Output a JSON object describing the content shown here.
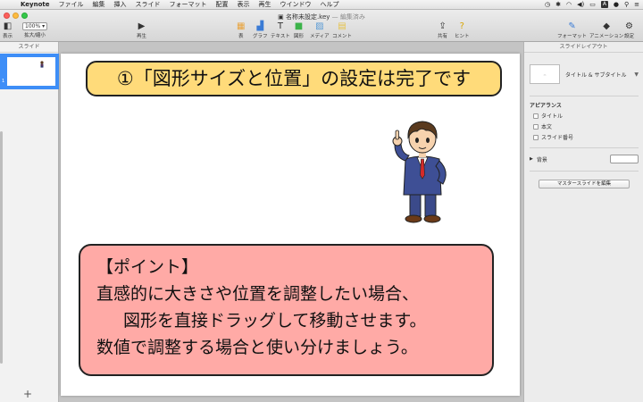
{
  "menubar": {
    "app_name": "Keynote",
    "items": [
      "ファイル",
      "編集",
      "挿入",
      "スライド",
      "フォーマット",
      "配置",
      "表示",
      "再生",
      "ウインドウ",
      "ヘルプ"
    ]
  },
  "window": {
    "doc_title": "名称未設定.key",
    "doc_status": " — 編集済み"
  },
  "toolbar": {
    "view_label": "表示",
    "zoom_value": "100%",
    "zoom_label": "拡大/縮小",
    "play_label": "再生",
    "table_label": "表",
    "chart_label": "グラフ",
    "text_label": "テキスト",
    "shape_label": "図形",
    "media_label": "メディア",
    "comment_label": "コメント",
    "share_label": "共有",
    "tips_label": "ヒント",
    "format_label": "フォーマット",
    "animate_label": "アニメーション",
    "setup_label": "設定"
  },
  "sidebar": {
    "header": "スライド",
    "slide_number": "1",
    "add_label": "+"
  },
  "slide": {
    "title": "①「図形サイズと位置」の設定は完了です",
    "point_lines": [
      "【ポイント】",
      "直感的に大きさや位置を調整したい場合、",
      "図形を直接ドラッグして移動させます。",
      "数値で調整する場合と使い分けましょう。"
    ]
  },
  "inspector": {
    "header": "スライドレイアウト",
    "layout_name": "タイトル & サブタイトル",
    "appearance_title": "アピアランス",
    "check_title": "タイトル",
    "check_body": "本文",
    "check_slide_number": "スライド番号",
    "background_label": "背景",
    "master_button": "マスタースライドを編集"
  }
}
